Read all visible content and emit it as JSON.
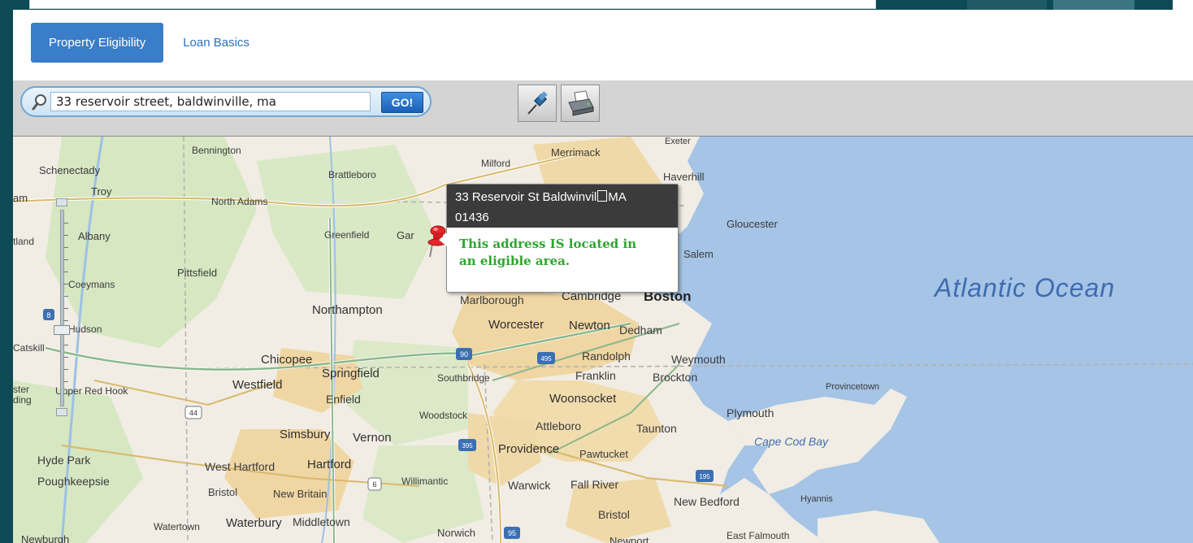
{
  "tabs": {
    "property_eligibility": "Property Eligibility",
    "loan_basics": "Loan Basics"
  },
  "search": {
    "value": "33 reservoir street, baldwinville, ma",
    "go_label": "GO!"
  },
  "toolbar": {
    "pin_icon": "pushpin-icon",
    "print_icon": "printer-icon"
  },
  "popup": {
    "line1": "33 Reservoir St Baldwinvil",
    "line1_end": "MA",
    "line2": "01436",
    "message_line1": "This address IS located in",
    "message_line2": "an eligible area."
  },
  "map_labels": {
    "bennington": "Bennington",
    "schenectady": "Schenectady",
    "troy": "Troy",
    "am": "am",
    "brattleboro": "Brattleboro",
    "north_adams": "North Adams",
    "milford": "Milford",
    "merrimack": "Merrimack",
    "exeter": "Exeter",
    "haverhill": "Haverhill",
    "albany": "Albany",
    "rutland": "tland",
    "greenfield": "Greenfield",
    "gardner": "Gar",
    "gloucester": "Gloucester",
    "salem": "Salem",
    "pittsfield": "Pittsfield",
    "coeymans": "Coeymans",
    "atlantic_ocean": "Atlantic Ocean",
    "marlborough": "Marlborough",
    "cambridge": "Cambridge",
    "boston": "Boston",
    "northampton": "Northampton",
    "hudson": "Hudson",
    "worcester": "Worcester",
    "newton": "Newton",
    "dedham": "Dedham",
    "catskill": "Catskill",
    "chicopee": "Chicopee",
    "randolph": "Randolph",
    "weymouth": "Weymouth",
    "springfield": "Springfield",
    "southbridge": "Southbridge",
    "franklin": "Franklin",
    "brockton": "Brockton",
    "westfield": "Westfield",
    "ster": "ster",
    "ding": "ding",
    "upper_red_hook": "Upper Red Hook",
    "enfield": "Enfield",
    "woonsocket": "Woonsocket",
    "provincetown": "Provincetown",
    "plymouth": "Plymouth",
    "woodstock": "Woodstock",
    "attleboro": "Attleboro",
    "taunton": "Taunton",
    "simsbury": "Simsbury",
    "vernon": "Vernon",
    "cape_cod_bay": "Cape Cod Bay",
    "hyde_park": "Hyde Park",
    "providence": "Providence",
    "pawtucket": "Pawtucket",
    "west_hartford": "West Hartford",
    "hartford": "Hartford",
    "poughkeepsie": "Poughkeepsie",
    "willimantic": "Willimantic",
    "warwick": "Warwick",
    "fall_river": "Fall River",
    "bristol_ct": "Bristol",
    "new_britain": "New Britain",
    "new_bedford": "New Bedford",
    "hyannis": "Hyannis",
    "bristol_ri": "Bristol",
    "watertown": "Watertown",
    "waterbury": "Waterbury",
    "middletown": "Middletown",
    "newburgh": "Newburgh",
    "norwich": "Norwich",
    "newport": "Newport",
    "east_falmouth": "East Falmouth"
  },
  "highway_shields": [
    "8",
    "90",
    "495",
    "44",
    "395",
    "6",
    "195",
    "95"
  ],
  "colors": {
    "ocean": "#a5c4e6",
    "land": "#f1ede4",
    "urban": "#efd6a3",
    "forest": "#cfe3b8",
    "tab_active": "#3a7dc9",
    "eligible_text": "#2ea62e"
  }
}
